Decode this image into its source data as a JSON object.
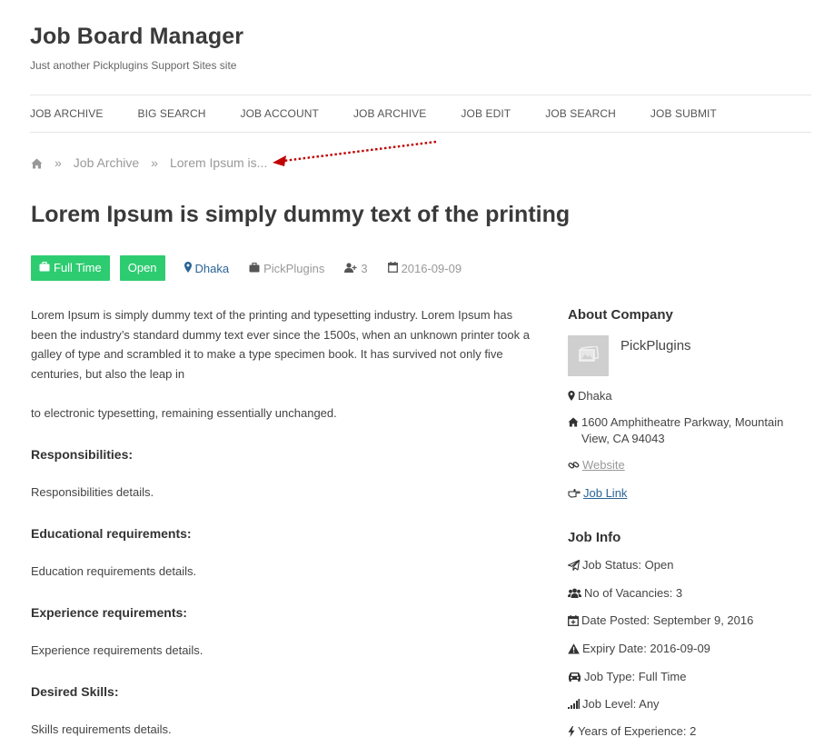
{
  "site": {
    "title": "Job Board Manager",
    "tagline": "Just another Pickplugins Support Sites site"
  },
  "nav": {
    "items": [
      "JOB ARCHIVE",
      "BIG SEARCH",
      "JOB ACCOUNT",
      "JOB ARCHIVE",
      "JOB EDIT",
      "JOB SEARCH",
      "JOB SUBMIT"
    ]
  },
  "breadcrumb": {
    "sep": "»",
    "archive": "Job Archive",
    "current": "Lorem Ipsum is..."
  },
  "job": {
    "title": "Lorem Ipsum is simply dummy text of the printing",
    "job_type": "Full Time",
    "status": "Open",
    "location": "Dhaka",
    "company": "PickPlugins",
    "vacancies": "3",
    "date": "2016-09-09"
  },
  "content": {
    "para1": "Lorem Ipsum is simply dummy text of the printing and typesetting industry. Lorem Ipsum has been the industry’s standard dummy text ever since the 1500s, when an unknown printer took a galley of type and scrambled it to make a type specimen book. It has survived not only five centuries, but also the leap in",
    "para2": "to electronic typesetting, remaining essentially unchanged.",
    "sections": [
      {
        "heading": "Responsibilities:",
        "detail": "Responsibilities details."
      },
      {
        "heading": "Educational requirements:",
        "detail": "Education requirements details."
      },
      {
        "heading": "Experience requirements:",
        "detail": "Experience requirements details."
      },
      {
        "heading": "Desired Skills:",
        "detail": "Skills requirements details."
      }
    ]
  },
  "sidebar": {
    "about_heading": "About Company",
    "company_name": "PickPlugins",
    "location": "Dhaka",
    "address": "1600 Amphitheatre Parkway, Mountain View, CA 94043",
    "website_label": "Website",
    "job_link_label": "Job Link",
    "info_heading": "Job Info",
    "info": {
      "status": "Job Status: Open",
      "vacancies": "No of Vacancies: 3",
      "date_posted": "Date Posted: September 9, 2016",
      "expiry": "Expiry Date: 2016-09-09",
      "type": "Job Type: Full Time",
      "level": "Job Level: Any",
      "experience": "Years of Experience: 2"
    }
  },
  "colors": {
    "badge_green": "#2ecc71",
    "link_blue": "#2a6496",
    "arrow_red": "#c00000"
  },
  "icons": [
    "home-icon",
    "briefcase-icon",
    "map-marker-icon",
    "user-plus-icon",
    "calendar-icon",
    "image-icon",
    "home-icon",
    "link-icon",
    "hand-pointer-icon",
    "paper-plane-icon",
    "users-icon",
    "calendar-plus-icon",
    "warning-icon",
    "car-icon",
    "signal-icon",
    "bolt-icon"
  ]
}
